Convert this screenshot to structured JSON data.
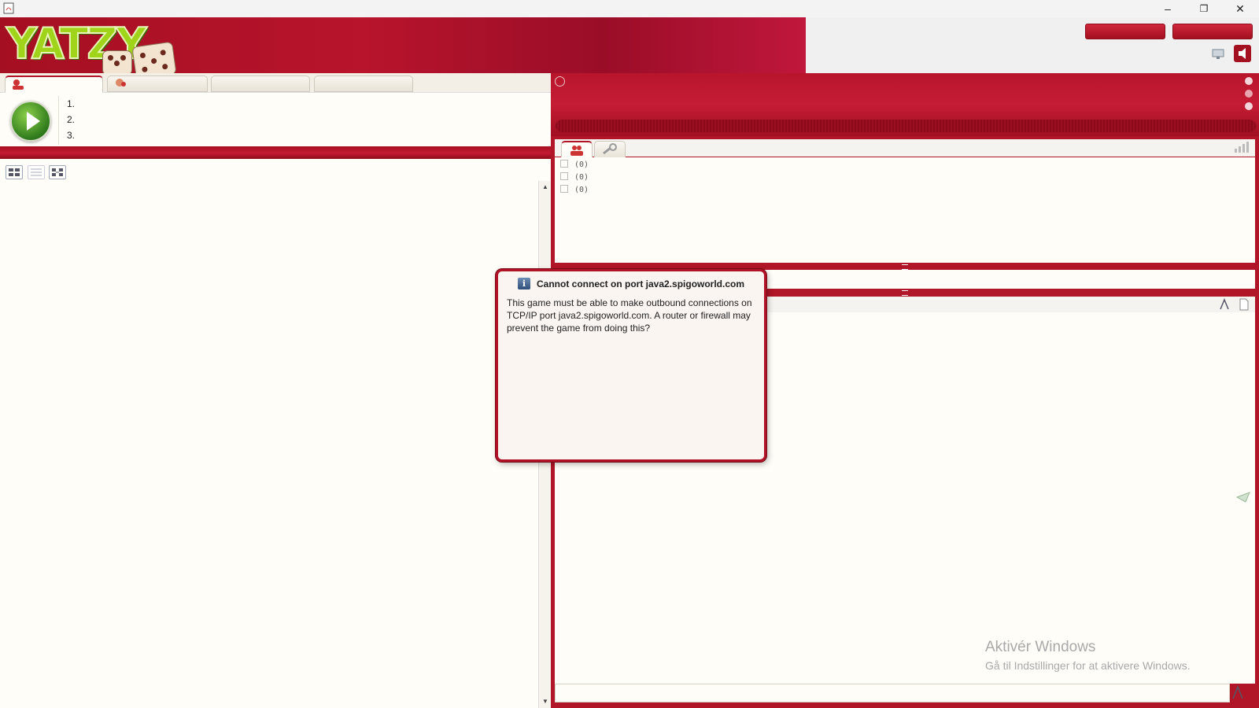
{
  "window": {
    "minimize_glyph": "–",
    "restore_glyph": "❐",
    "close_glyph": "✕"
  },
  "header": {
    "logo_text": "YATZY"
  },
  "queue": {
    "items": [
      "1.",
      "2.",
      "3."
    ]
  },
  "userlist": {
    "groups": [
      "(0)",
      "(0)",
      "(0)"
    ]
  },
  "dialog": {
    "title": "Cannot connect on port java2.spigoworld.com",
    "body": "This game must be able to make outbound connections on TCP/IP port java2.spigoworld.com. A router or firewall may prevent the game from doing this?",
    "icon_letter": "i"
  },
  "watermark": {
    "line1": "Aktivér Windows",
    "line2": "Gå til Indstillinger for at aktivere Windows."
  },
  "colors": {
    "brand_red": "#b01628",
    "logo_green": "#9fd41a"
  }
}
